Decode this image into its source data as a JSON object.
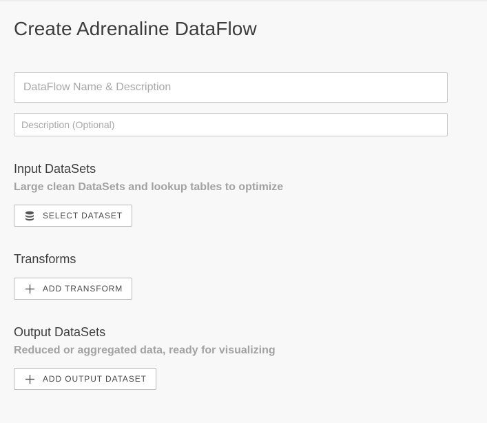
{
  "page": {
    "title": "Create Adrenaline DataFlow"
  },
  "form": {
    "name_placeholder": "DataFlow Name & Description",
    "name_value": "",
    "description_placeholder": "Description (Optional)",
    "description_value": ""
  },
  "sections": {
    "input": {
      "title": "Input DataSets",
      "subtitle": "Large clean DataSets and lookup tables to optimize",
      "button_label": "SELECT DATASET",
      "button_icon": "database-icon"
    },
    "transforms": {
      "title": "Transforms",
      "button_label": "ADD TRANSFORM",
      "button_icon": "plus-icon"
    },
    "output": {
      "title": "Output DataSets",
      "subtitle": "Reduced or aggregated data, ready for visualizing",
      "button_label": "ADD OUTPUT DATASET",
      "button_icon": "plus-icon"
    }
  },
  "colors": {
    "background": "#f8f8f8",
    "text": "#3d3d3d",
    "subtext": "#a2a2a2",
    "border": "#c8c8c8"
  }
}
